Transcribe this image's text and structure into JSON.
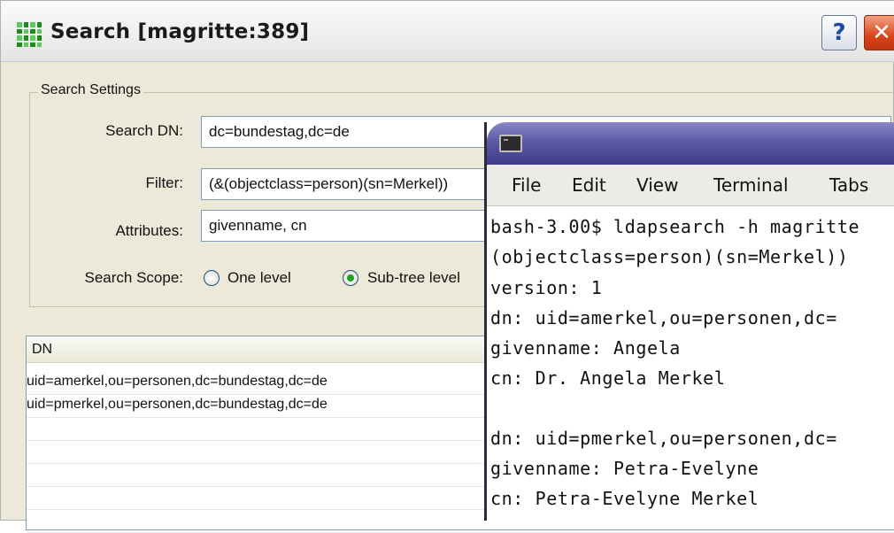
{
  "dialog": {
    "title": "Search [magritte:389]",
    "help_label": "?",
    "close_label": "✕",
    "settings_legend": "Search Settings",
    "search_dn": {
      "label": "Search DN:",
      "value": "dc=bundestag,dc=de"
    },
    "filter": {
      "label": "Filter:",
      "value": "(&(objectclass=person)(sn=Merkel))"
    },
    "attributes": {
      "label": "Attributes:",
      "value": "givenname, cn"
    },
    "scope": {
      "label": "Search Scope:",
      "options": [
        {
          "label": "One level",
          "selected": false
        },
        {
          "label": "Sub-tree level",
          "selected": true
        }
      ]
    },
    "results": {
      "column": "DN",
      "rows": [
        "uid=amerkel,ou=personen,dc=bundestag,dc=de",
        "uid=pmerkel,ou=personen,dc=bundestag,dc=de"
      ]
    }
  },
  "terminal": {
    "menu": [
      "File",
      "Edit",
      "View",
      "Terminal",
      "Tabs"
    ],
    "lines": [
      "bash-3.00$ ldapsearch -h magritte",
      "(objectclass=person)(sn=Merkel))",
      "version: 1",
      "dn: uid=amerkel,ou=personen,dc=",
      "givenname: Angela",
      "cn: Dr. Angela Merkel",
      "",
      "dn: uid=pmerkel,ou=personen,dc=",
      "givenname: Petra-Evelyne",
      "cn: Petra-Evelyne Merkel"
    ]
  }
}
